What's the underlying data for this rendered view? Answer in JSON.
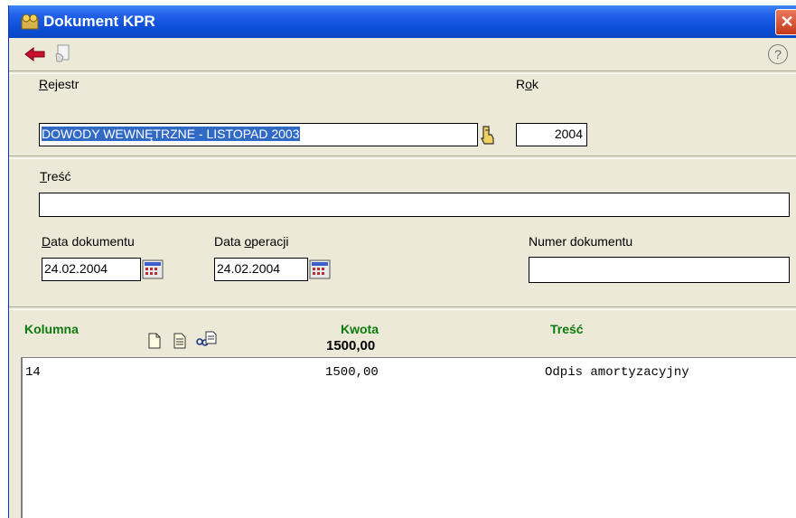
{
  "window": {
    "title": "Dokument KPR",
    "close_symbol": "✕"
  },
  "toolbar": {
    "help_symbol": "?"
  },
  "form": {
    "rejestr": {
      "label_u": "R",
      "label_rest": "ejestr",
      "value": "DOWODY WEWNĘTRZNE - LISTOPAD 2003"
    },
    "rok": {
      "label_pre": "R",
      "label_u": "o",
      "label_rest": "k",
      "value": "2004"
    },
    "tresc": {
      "label_u": "T",
      "label_rest": "reść",
      "value": ""
    },
    "data_dokumentu": {
      "label_u": "D",
      "label_rest": "ata dokumentu",
      "value": "24.02.2004"
    },
    "data_operacji": {
      "label_pre": "Data ",
      "label_u": "o",
      "label_rest": "peracji",
      "value": "24.02.2004"
    },
    "numer_dokumentu": {
      "label": "Numer dokumentu",
      "value": ""
    }
  },
  "grid": {
    "headers": {
      "kolumna": "Kolumna",
      "kwota": "Kwota",
      "tresc": "Treść"
    },
    "total": "1500,00",
    "rows": [
      {
        "kolumna": "14",
        "kwota": "1500,00",
        "tresc": "Odpis amortyzacyjny"
      }
    ]
  },
  "colors": {
    "title_bar": "#0a46c4",
    "header_green": "#0c7a0c",
    "selection": "#316ac5",
    "window_bg": "#ece9d8"
  }
}
